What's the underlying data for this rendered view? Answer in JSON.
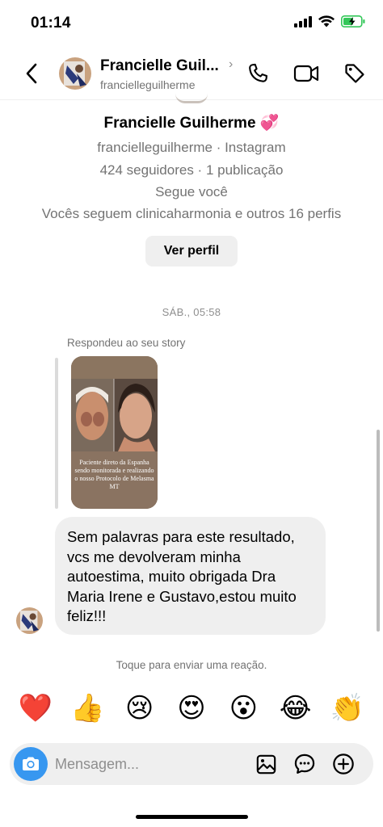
{
  "status_bar": {
    "time": "01:14"
  },
  "header": {
    "name": "Francielle Guil...",
    "username": "francielleguilherme"
  },
  "profile": {
    "name": "Francielle Guilherme 💞",
    "source": "francielleguilherme · Instagram",
    "stats": "424 seguidores · 1 publicação",
    "follows_you": "Segue você",
    "mutuals": "Vocês seguem clinicaharmonia e outros 16 perfis",
    "view_profile_label": "Ver perfil"
  },
  "chat": {
    "timestamp": "SÁB., 05:58",
    "replied_label": "Respondeu ao seu story",
    "story_caption": "Paciente direto da Espanha sendo monitorada e realizando o nosso Protocolo de Melasma MT",
    "message": "Sem palavras para este resultado, vcs me devolveram minha autoestima, muito obrigada Dra Maria Irene e Gustavo,estou muito feliz!!!",
    "reaction_hint": "Toque para enviar uma reação."
  },
  "reactions": [
    "❤️",
    "👍",
    "😢",
    "😍",
    "😮",
    "😂",
    "👏"
  ],
  "composer": {
    "placeholder": "Mensagem..."
  },
  "colors": {
    "accent": "#3797f0",
    "bubble": "#efefef",
    "battery": "#34c759"
  }
}
